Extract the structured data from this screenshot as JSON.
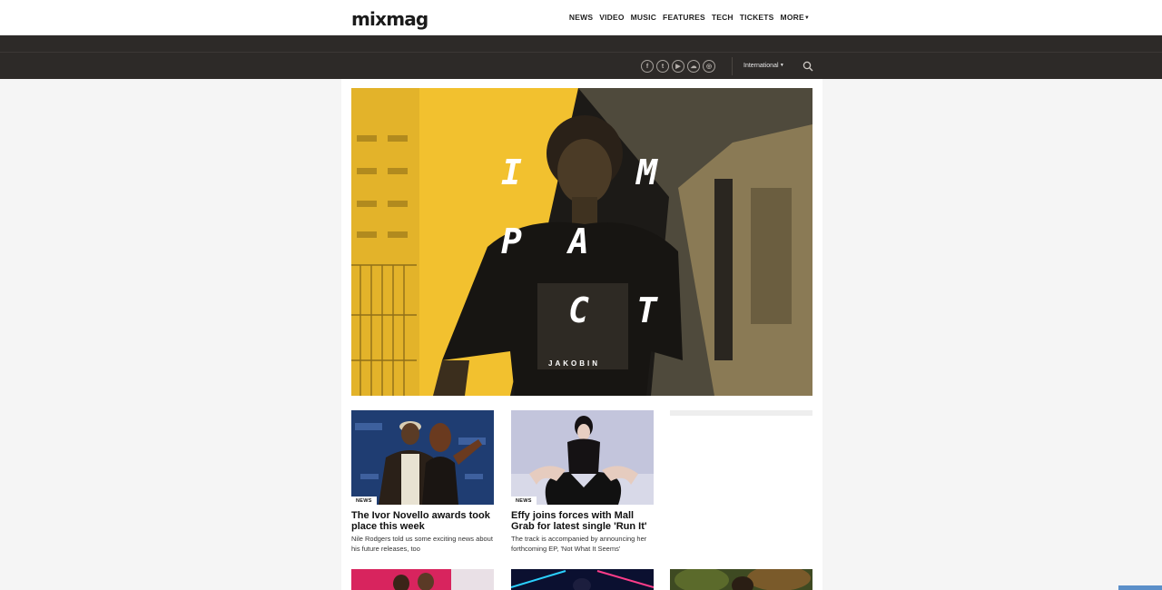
{
  "brand": {
    "logo": "mixmag"
  },
  "nav": {
    "items": [
      "NEWS",
      "VIDEO",
      "MUSIC",
      "FEATURES",
      "TECH",
      "TICKETS"
    ],
    "more": "MORE"
  },
  "utility": {
    "social": [
      {
        "icon": "facebook-icon",
        "glyph": "f"
      },
      {
        "icon": "twitter-icon",
        "glyph": "t"
      },
      {
        "icon": "youtube-icon",
        "glyph": "▶"
      },
      {
        "icon": "soundcloud-icon",
        "glyph": "☁"
      },
      {
        "icon": "instagram-icon",
        "glyph": "◎"
      }
    ],
    "region": "International"
  },
  "hero": {
    "letters": [
      "I",
      "M",
      "P",
      "A",
      "C",
      "T"
    ],
    "caption": "JAKOBIN",
    "colors": {
      "yellow": "#f2c12f",
      "dark": "#1c1a17"
    }
  },
  "cards": [
    {
      "badge": "NEWS",
      "title": "The Ivor Novello awards took place this week",
      "desc": "Nile Rodgers told us some exciting news about his future releases, too"
    },
    {
      "badge": "NEWS",
      "title": "Effy joins forces with Mall Grab for latest single 'Run It'",
      "desc": "The track is accompanied by announcing her forthcoming EP, 'Not What It Seems'"
    }
  ],
  "colors": {
    "header_dark": "#2d2a28",
    "page_bg": "#f5f5f5",
    "accent_blue": "#5b8fc9"
  }
}
